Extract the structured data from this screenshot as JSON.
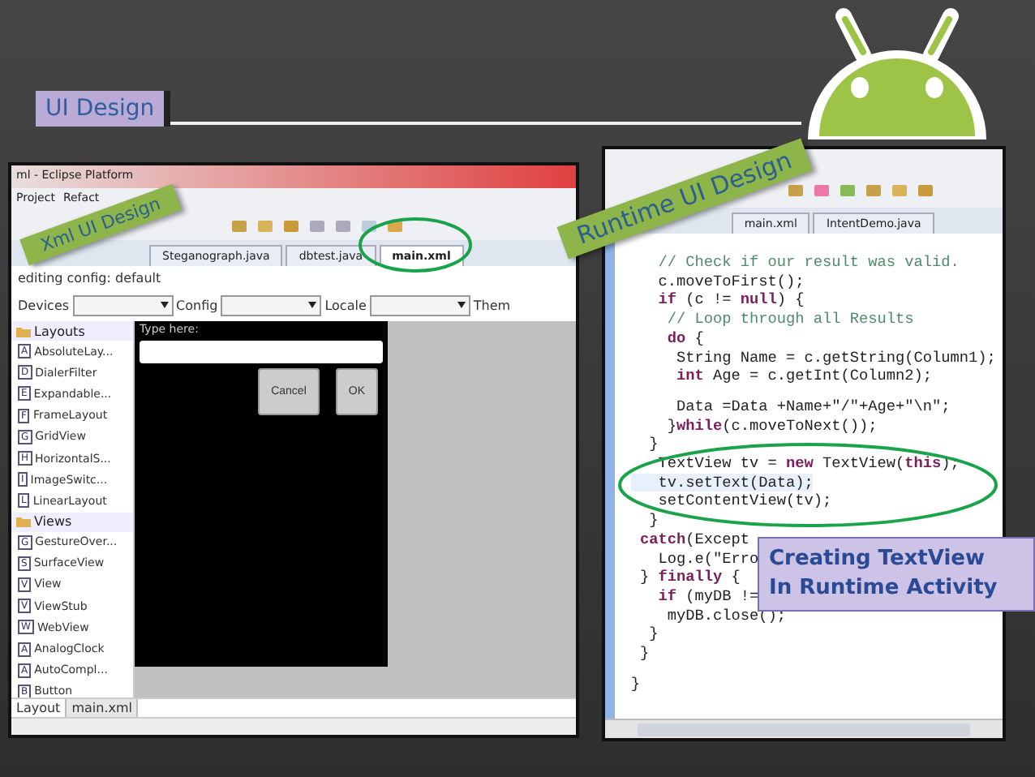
{
  "slide": {
    "title": "UI Design",
    "labels": [
      "Xml UI Design",
      "Runtime UI Design"
    ],
    "callout": [
      "Creating TextView",
      "In Runtime Activity"
    ]
  },
  "xml_window": {
    "title": "ml - Eclipse Platform",
    "menu": [
      "Project",
      "Refact"
    ],
    "tabs": [
      {
        "label": "Steganograph.java",
        "selected": false
      },
      {
        "label": "dbtest.java",
        "selected": false
      },
      {
        "label": "main.xml",
        "selected": true
      }
    ],
    "config_line": "editing config: default",
    "config_fields": [
      "Devices",
      "Config",
      "Locale",
      "Them"
    ],
    "palette": [
      {
        "label": "Layouts",
        "kind": "group",
        "children": [
          {
            "label": "AbsoluteLay...",
            "badge": "A"
          },
          {
            "label": "DialerFilter",
            "badge": "D"
          },
          {
            "label": "Expandable...",
            "badge": "E"
          },
          {
            "label": "FrameLayout",
            "badge": "F"
          },
          {
            "label": "GridView",
            "badge": "G"
          },
          {
            "label": "HorizontalS...",
            "badge": "H"
          },
          {
            "label": "ImageSwitc...",
            "badge": "I"
          },
          {
            "label": "LinearLayout",
            "badge": "L"
          }
        ]
      },
      {
        "label": "Views",
        "kind": "group",
        "children": [
          {
            "label": "GestureOver...",
            "badge": "G"
          },
          {
            "label": "SurfaceView",
            "badge": "S"
          },
          {
            "label": "View",
            "badge": "V"
          },
          {
            "label": "ViewStub",
            "badge": "V"
          },
          {
            "label": "WebView",
            "badge": "W"
          },
          {
            "label": "AnalogClock",
            "badge": "A"
          },
          {
            "label": "AutoCompl...",
            "badge": "A"
          },
          {
            "label": "Button",
            "badge": "B"
          }
        ]
      }
    ],
    "device": {
      "prompt": "Type here:",
      "buttons": [
        "Cancel",
        "OK"
      ]
    },
    "bottom_tabs": [
      {
        "label": "Layout",
        "selected": true
      },
      {
        "label": "main.xml",
        "selected": false
      }
    ]
  },
  "code_window": {
    "tabs": [
      {
        "label": "main.xml",
        "selected": false
      },
      {
        "label": "IntentDemo.java",
        "selected": false
      }
    ],
    "lines": [
      {
        "text": "   // Check if our result was valid.",
        "kind": "comment"
      },
      {
        "text": "   c.moveToFirst();",
        "kind": "code"
      },
      {
        "text": "   **if** (c != **null**) {",
        "kind": "code"
      },
      {
        "text": "    // Loop through all Results",
        "kind": "comment"
      },
      {
        "text": "    **do** {",
        "kind": "code"
      },
      {
        "text": "     String Name = c.getString(Column1);",
        "kind": "code"
      },
      {
        "text": "     **int** Age = c.getInt(Column2);",
        "kind": "code"
      },
      {
        "text": "     Data =Data +Name+\"/\"+Age+\"\\n\";",
        "kind": "code",
        "spaced": true
      },
      {
        "text": "    }**while**(c.moveToNext());",
        "kind": "code"
      },
      {
        "text": "  }",
        "kind": "code"
      },
      {
        "text": "   TextView tv = **new** TextView(**this**);",
        "kind": "code"
      },
      {
        "text": "   tv.setText(Data);",
        "kind": "code",
        "current": true
      },
      {
        "text": "   setContentView(tv);",
        "kind": "code"
      },
      {
        "text": "  }",
        "kind": "code"
      },
      {
        "text": " **catch**(Except",
        "kind": "code"
      },
      {
        "text": "   Log.e(\"Erro",
        "kind": "code"
      },
      {
        "text": " } **finally** {",
        "kind": "code"
      },
      {
        "text": "   **if** (myDB !=",
        "kind": "code"
      },
      {
        "text": "    myDB.close();",
        "kind": "code"
      },
      {
        "text": "  }",
        "kind": "code"
      },
      {
        "text": " }",
        "kind": "code"
      },
      {
        "text": "}",
        "kind": "code",
        "spaced": true
      }
    ]
  }
}
